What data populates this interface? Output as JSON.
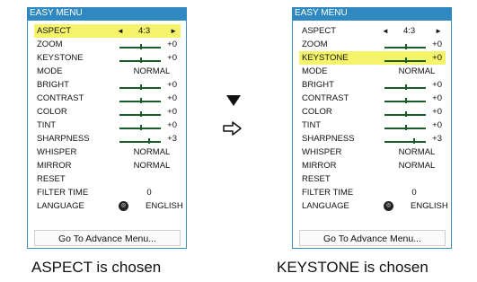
{
  "menu_title": "EASY MENU",
  "rows": {
    "aspect": {
      "label": "ASPECT",
      "value": "4:3"
    },
    "zoom": {
      "label": "ZOOM",
      "value": "+0"
    },
    "keystone": {
      "label": "KEYSTONE",
      "value": "+0"
    },
    "mode": {
      "label": "MODE",
      "value": "NORMAL"
    },
    "bright": {
      "label": "BRIGHT",
      "value": "+0"
    },
    "contrast": {
      "label": "CONTRAST",
      "value": "+0"
    },
    "color": {
      "label": "COLOR",
      "value": "+0"
    },
    "tint": {
      "label": "TINT",
      "value": "+0"
    },
    "sharpness": {
      "label": "SHARPNESS",
      "value": "+3"
    },
    "whisper": {
      "label": "WHISPER",
      "value": "NORMAL"
    },
    "mirror": {
      "label": "MIRROR",
      "value": "NORMAL"
    },
    "reset": {
      "label": "RESET"
    },
    "filter_time": {
      "label": "FILTER TIME",
      "value": "0"
    },
    "language": {
      "label": "LANGUAGE",
      "value": "ENGLISH",
      "icon": "globe-icon"
    }
  },
  "advance_button": "Go To Advance Menu...",
  "captions": {
    "left": "ASPECT is chosen",
    "right": "KEYSTONE is chosen"
  },
  "colors": {
    "title_bar": "#2f88bf",
    "highlight": "#f4f36a",
    "slider": "#1a5b2a"
  }
}
